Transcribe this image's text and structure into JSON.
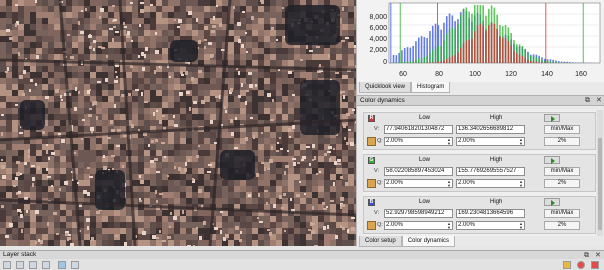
{
  "histogram": {
    "y_ticks": [
      "8,000",
      "6,000",
      "4,000",
      "2,000",
      "0"
    ],
    "x_ticks": [
      "60",
      "80",
      "100",
      "120",
      "140",
      "160"
    ]
  },
  "view_tabs": [
    {
      "label": "Quicklook view",
      "active": false
    },
    {
      "label": "Histogram",
      "active": true
    }
  ],
  "color_dynamics": {
    "title": "Color dynamics",
    "channels": [
      {
        "badge": "R",
        "color": "#e03030",
        "low_header": "Low",
        "high_header": "High",
        "v_label": "V:",
        "q_label": "Q:",
        "v_low": "77.940618201304872",
        "v_high": "136.3402656689812",
        "q_low": "2.00%",
        "q_high": "2.00%",
        "btn1": "min/Max",
        "btn2": "2%"
      },
      {
        "badge": "G",
        "color": "#2cb42c",
        "low_header": "Low",
        "high_header": "High",
        "v_label": "V:",
        "q_label": "Q:",
        "v_low": "58.022085897453024",
        "v_high": "155.77692695557527",
        "q_low": "2.00%",
        "q_high": "2.00%",
        "btn1": "min/Max",
        "btn2": "2%"
      },
      {
        "badge": "B",
        "color": "#3050d8",
        "low_header": "Low",
        "high_header": "High",
        "v_label": "V:",
        "q_label": "Q:",
        "v_low": "52.929798598949212",
        "v_high": "169.2304813664596",
        "q_low": "2.00%",
        "q_high": "2.00%",
        "btn1": "min/Max",
        "btn2": "2%"
      }
    ]
  },
  "bottom_tabs": [
    {
      "label": "Color setup",
      "active": false
    },
    {
      "label": "Color dynamics",
      "active": true
    }
  ],
  "layer_stack": {
    "title": "Layer stack"
  },
  "colors": {
    "red": "#e03030",
    "green": "#2cb42c",
    "blue": "#3050d8"
  }
}
